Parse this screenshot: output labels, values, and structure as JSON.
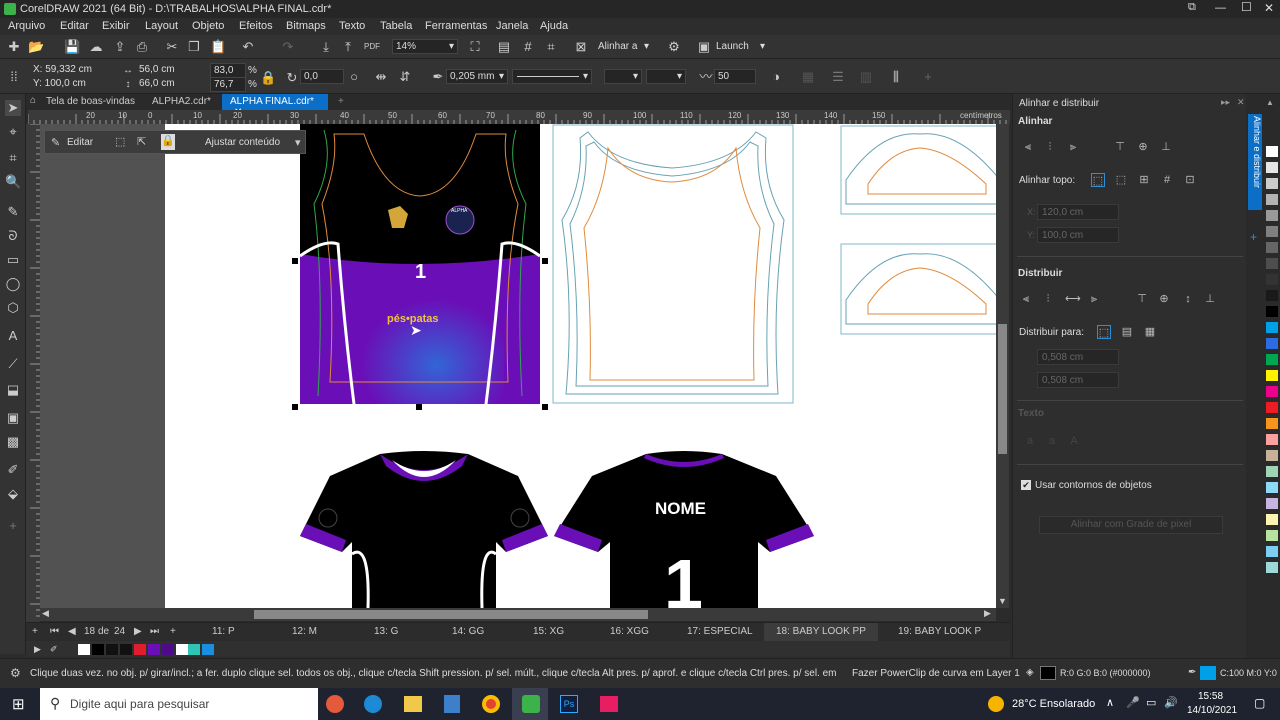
{
  "window": {
    "title": "CorelDRAW 2021 (64 Bit) - D:\\TRABALHOS\\ALPHA FINAL.cdr*"
  },
  "menu": [
    "Arquivo",
    "Editar",
    "Exibir",
    "Layout",
    "Objeto",
    "Efeitos",
    "Bitmaps",
    "Texto",
    "Tabela",
    "Ferramentas",
    "Janela",
    "Ajuda"
  ],
  "toolbar": {
    "zoom": "14%",
    "align_label": "Alinhar a",
    "launch_label": "Launch"
  },
  "props": {
    "x": "X: 59,332 cm",
    "y": "Y: 100,0 cm",
    "w": "56,0 cm",
    "h": "66,0 cm",
    "sx": "83,0",
    "sy": "76,7",
    "pct": "%",
    "rotation": "0,0",
    "outline": "0,205 mm",
    "transparency": "50"
  },
  "doc_tabs": [
    "Tela de boas-vindas",
    "ALPHA2.cdr*",
    "ALPHA FINAL.cdr*"
  ],
  "ruler_unit": "centímetros",
  "ruler_ticks": [
    "20",
    "10",
    "0",
    "10",
    "20",
    "30",
    "40",
    "50",
    "60",
    "70",
    "80",
    "90",
    "100",
    "110",
    "120",
    "130",
    "140",
    "150",
    "160",
    "170",
    "180",
    "190"
  ],
  "powerclip": {
    "edit": "Editar",
    "adjust": "Ajustar conteúdo"
  },
  "artwork": {
    "badge_text": "ALPHA",
    "number": "1",
    "name_text": "NOME",
    "back_number": "1",
    "sponsor_text": "pés•patas"
  },
  "page_nav": {
    "current": "18",
    "of": "de",
    "total": "24"
  },
  "page_tabs": [
    "11: P",
    "12: M",
    "13: G",
    "14: GG",
    "15: XG",
    "16: XGG",
    "17: ESPECIAL",
    "18: BABY LOOK PP",
    "19: BABY LOOK P"
  ],
  "status": {
    "hint": "Clique duas vez. no obj. p/ girar/incl.; a fer. duplo clique sel. todos os obj., clique c/tecla Shift pression. p/ sel. múlt., clique c/tecla Alt pres. p/ aprof. e clique c/tecla Ctrl pres. p/ sel. em grupo",
    "action": "Fazer PowerClip de curva em Layer 1",
    "fill": "R:0 G:0 B:0 (#000000)",
    "outline": "C:100 M:0 Y:0"
  },
  "docker": {
    "title": "Alinhar e distribuir",
    "align_section": "Alinhar",
    "align_top_label": "Alinhar topo:",
    "x_field": "120,0 cm",
    "y_field": "100,0 cm",
    "distribute_section": "Distribuir",
    "distribute_to_label": "Distribuir para:",
    "d1": "0,508 cm",
    "d2": "0,508 cm",
    "text_section": "Texto",
    "use_outlines": "Usar contornos de objetos",
    "grid_button": "Alinhar com Grade de pixel",
    "side_tab": "Alinhar e distribuir"
  },
  "taskbar": {
    "search_placeholder": "Digite aqui para pesquisar",
    "weather": "28°C  Ensolarado",
    "time": "15:58",
    "date": "14/10/2021"
  },
  "colors": {
    "purple": "#6a0fb8",
    "accent": "#0078d7",
    "black": "#000000"
  }
}
